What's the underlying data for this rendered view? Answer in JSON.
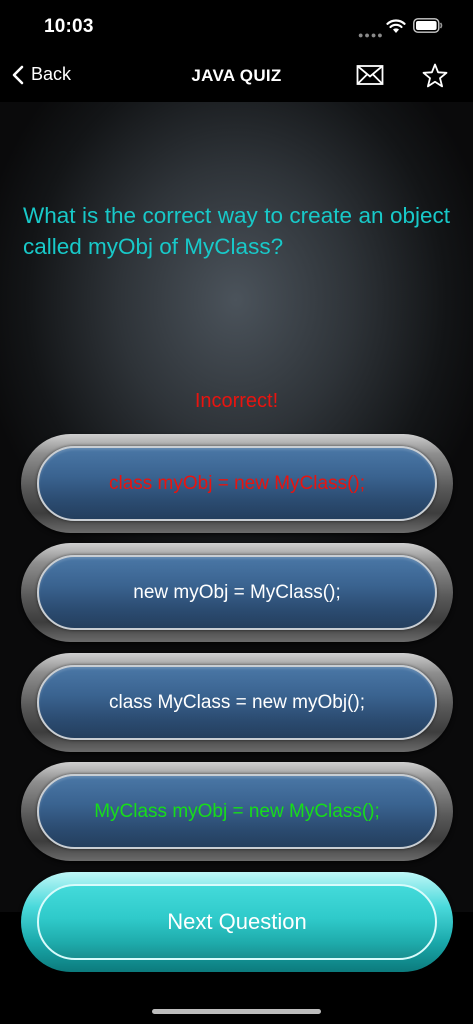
{
  "status_bar": {
    "time": "10:03"
  },
  "nav": {
    "back_label": "Back",
    "title": "JAVA QUIZ",
    "icons": [
      "chevron-left-icon",
      "mail-icon",
      "star-icon"
    ]
  },
  "quiz": {
    "question": "What is the correct way to create an object called myObj of MyClass?",
    "feedback": "Incorrect!",
    "answers": [
      {
        "label": "class myObj = new MyClass();",
        "state": "selected-incorrect"
      },
      {
        "label": "new myObj = MyClass();",
        "state": "default"
      },
      {
        "label": "class MyClass = new myObj();",
        "state": "default"
      },
      {
        "label": "MyClass myObj = new MyClass();",
        "state": "correct"
      }
    ],
    "next_label": "Next Question"
  },
  "colors": {
    "question_text": "#18c9c9",
    "incorrect": "#e8140f",
    "correct": "#17dd1a",
    "next_button": "#2fcaca"
  }
}
